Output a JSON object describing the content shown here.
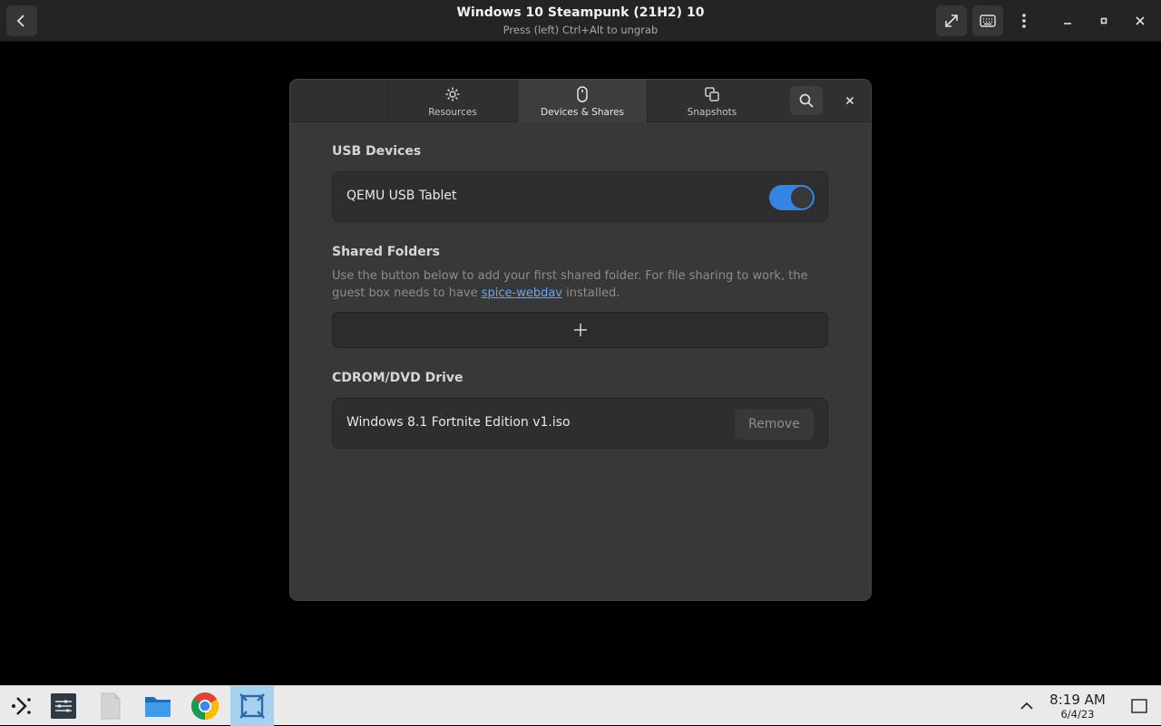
{
  "titlebar": {
    "title": "Windows 10 Steampunk (21H2) 10",
    "subtitle": "Press (left) Ctrl+Alt to ungrab",
    "buttons": [
      "back-icon",
      "fullscreen-icon",
      "keyboard-icon",
      "menu-icon",
      "minimize-icon",
      "maximize-icon",
      "close-icon"
    ]
  },
  "dialog": {
    "tabs": [
      {
        "label": "Resources",
        "icon": "gear-icon"
      },
      {
        "label": "Devices & Shares",
        "icon": "mouse-icon",
        "active": true
      },
      {
        "label": "Snapshots",
        "icon": "copy-icon"
      }
    ],
    "usb": {
      "title": "USB Devices",
      "device": "QEMU USB Tablet",
      "enabled": true
    },
    "shared": {
      "title": "Shared Folders",
      "desc_pre": "Use the button below to add your first shared folder. For file sharing to work, the guest box needs to have ",
      "desc_link": "spice-webdav",
      "desc_post": " installed.",
      "add_icon": "plus-icon"
    },
    "cdrom": {
      "title": "CDROM/DVD Drive",
      "file": "Windows 8.1 Fortnite Edition v1.iso",
      "remove_label": "Remove"
    }
  },
  "taskbar": {
    "items": [
      "launcher-icon",
      "settings-panel-icon",
      "file-icon",
      "folder-icon",
      "chrome-icon",
      "boxes-icon"
    ],
    "active_item": "boxes-icon",
    "time": "8:19 AM",
    "date": "6/4/23"
  },
  "colors": {
    "accent": "#3584e4",
    "taskbar_active": "#a8d1ef"
  }
}
